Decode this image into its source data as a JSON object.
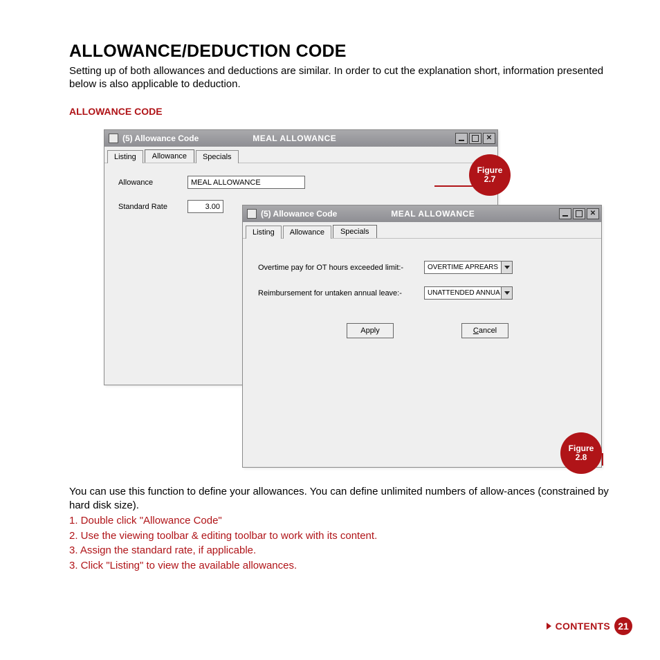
{
  "heading": "ALLOWANCE/DEDUCTION CODE",
  "intro": "Setting up of both allowances and deductions are similar. In order to cut the explanation short, information presented below is also applicable to deduction.",
  "subheading": "ALLOWANCE CODE",
  "win1": {
    "title_a": "(5)  Allowance Code",
    "title_b": "MEAL ALLOWANCE",
    "tabs": {
      "listing": "Listing",
      "allowance": "Allowance",
      "specials": "Specials"
    },
    "fields": {
      "allowance_label": "Allowance",
      "allowance_value": "MEAL ALLOWANCE",
      "rate_label": "Standard Rate",
      "rate_value": "3.00"
    }
  },
  "win2": {
    "title_a": "(5)  Allowance Code",
    "title_b": "MEAL ALLOWANCE",
    "tabs": {
      "listing": "Listing",
      "allowance": "Allowance",
      "specials": "Specials"
    },
    "fields": {
      "ot_label": "Overtime pay for OT hours exceeded limit:-",
      "ot_value": "OVERTIME APREARS",
      "leave_label": "Reimbursement for untaken annual leave:-",
      "leave_value": "UNATTENDED ANNUA"
    },
    "buttons": {
      "apply": "Apply",
      "cancel": "Cancel",
      "cancel_u": "C",
      "cancel_rest": "ancel"
    }
  },
  "badges": {
    "fig27_a": "Figure",
    "fig27_b": "2.7",
    "fig28_a": "Figure",
    "fig28_b": "2.8"
  },
  "para2": "You can use this function to define your allowances. You can define unlimited numbers of allow-ances (constrained by hard disk size).",
  "steps": {
    "s1": "1. Double click \"Allowance Code\"",
    "s2": "2. Use the viewing toolbar & editing toolbar to work with its content.",
    "s3": "3. Assign the standard rate, if applicable.",
    "s4": "3. Click \"Listing\" to view the available allowances."
  },
  "footer": {
    "contents": "CONTENTS",
    "page": "21"
  }
}
